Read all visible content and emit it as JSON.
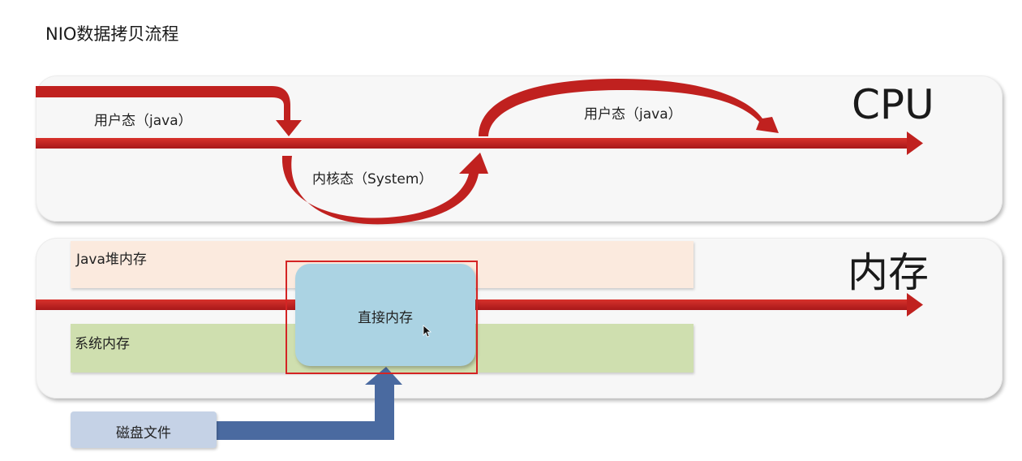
{
  "title": "NIO数据拷贝流程",
  "cpu": {
    "label": "CPU",
    "user_mode_1": "用户态（java）",
    "kernel_mode": "内核态（System）",
    "user_mode_2": "用户态（java）"
  },
  "memory": {
    "label": "内存",
    "java_heap": "Java堆内存",
    "system_memory": "系统内存",
    "direct_memory": "直接内存"
  },
  "disk": {
    "label": "磁盘文件"
  },
  "colors": {
    "arrow_red": "#c0211f",
    "arrow_blue": "#4a6aa0",
    "highlight_border": "#d42424"
  }
}
